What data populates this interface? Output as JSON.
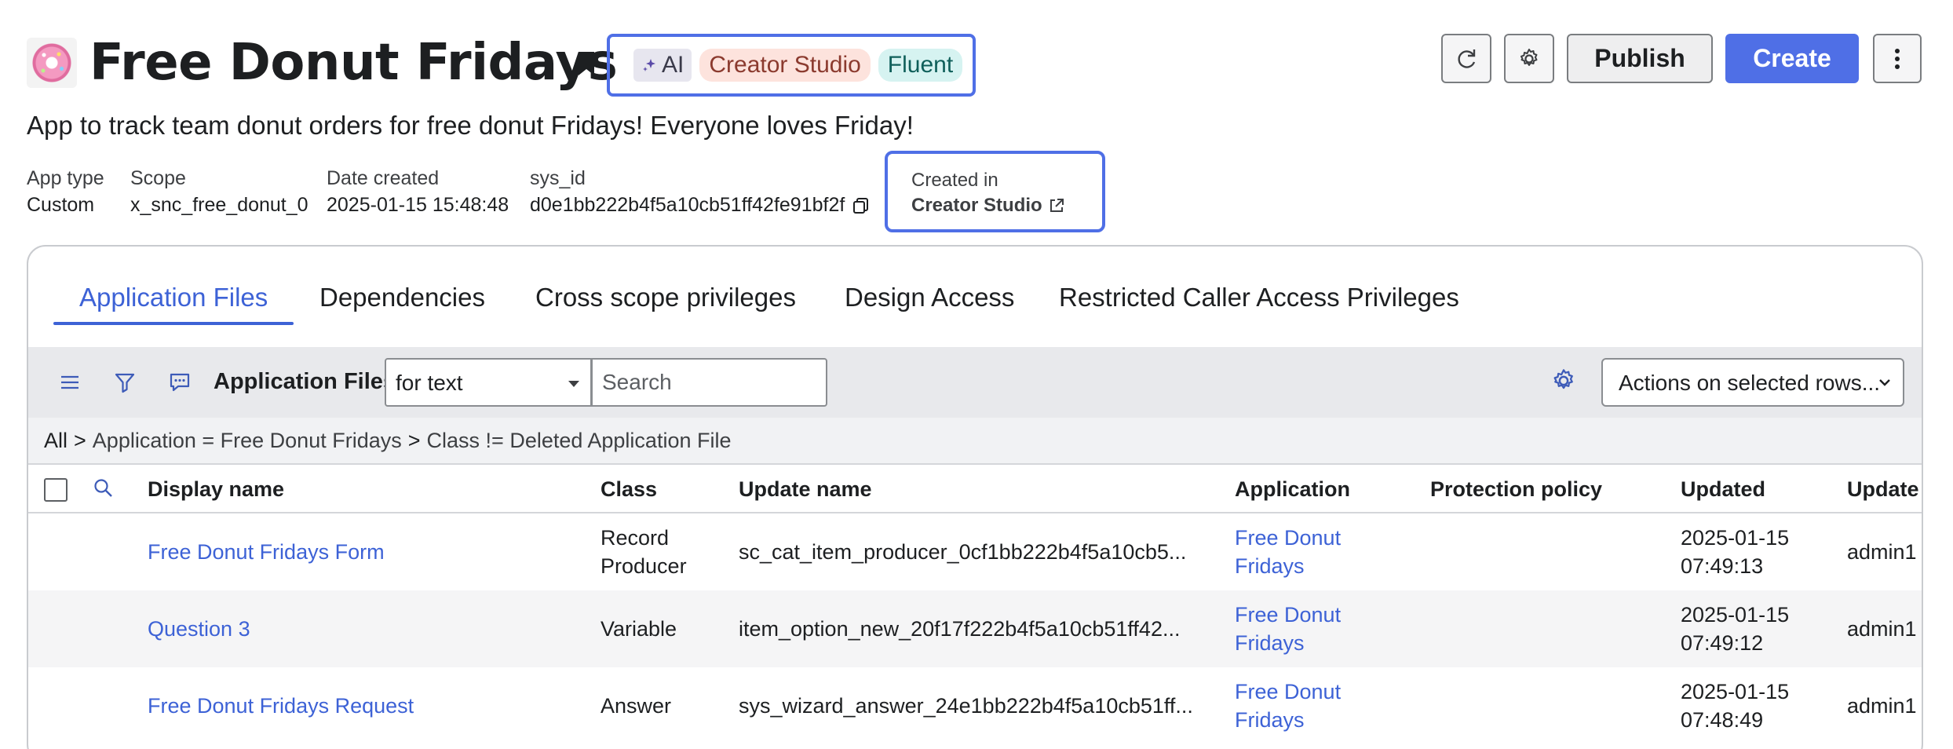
{
  "header": {
    "title": "Free Donut Fridays",
    "subtitle": "App to track team donut orders for free donut Fridays! Everyone loves Friday!",
    "tags": {
      "ai": "AI",
      "creator": "Creator Studio",
      "fluent": "Fluent"
    },
    "meta": {
      "app_type_label": "App type",
      "app_type": "Custom",
      "scope_label": "Scope",
      "scope": "x_snc_free_donut_0",
      "date_created_label": "Date created",
      "date_created": "2025-01-15 15:48:48",
      "sys_id_label": "sys_id",
      "sys_id": "d0e1bb222b4f5a10cb51ff42fe91bf2f",
      "created_in_label": "Created in",
      "created_in": "Creator Studio"
    },
    "buttons": {
      "publish": "Publish",
      "create": "Create"
    }
  },
  "tabs": [
    {
      "label": "Application Files"
    },
    {
      "label": "Dependencies"
    },
    {
      "label": "Cross scope privileges"
    },
    {
      "label": "Design Access"
    },
    {
      "label": "Restricted Caller Access Privileges"
    }
  ],
  "toolbar": {
    "label": "Application Files",
    "select_value": "for text",
    "search_placeholder": "Search",
    "actions_label": "Actions on selected rows..."
  },
  "breadcrumb": {
    "all": "All",
    "sep": ">",
    "filter1": "Application = Free Donut Fridays",
    "filter2": "Class != Deleted Application File"
  },
  "table": {
    "columns": {
      "display_name": "Display name",
      "class": "Class",
      "update_name": "Update name",
      "application": "Application",
      "protection_policy": "Protection policy",
      "updated": "Updated",
      "updated_by": "Update"
    },
    "rows": [
      {
        "display_name": "Free Donut Fridays Form",
        "class_1": "Record",
        "class_2": "Producer",
        "update_name": "sc_cat_item_producer_0cf1bb222b4f5a10cb5...",
        "app_1": "Free Donut",
        "app_2": "Fridays",
        "date": "2025-01-15",
        "time": "07:49:13",
        "by": "admin1"
      },
      {
        "display_name": "Question 3",
        "class_1": "Variable",
        "class_2": "",
        "update_name": "item_option_new_20f17f222b4f5a10cb51ff42...",
        "app_1": "Free Donut",
        "app_2": "Fridays",
        "date": "2025-01-15",
        "time": "07:49:12",
        "by": "admin1"
      },
      {
        "display_name": "Free Donut Fridays Request",
        "class_1": "Answer",
        "class_2": "",
        "update_name": "sys_wizard_answer_24e1bb222b4f5a10cb51ff...",
        "app_1": "Free Donut",
        "app_2": "Fridays",
        "date": "2025-01-15",
        "time": "07:48:49",
        "by": "admin1"
      }
    ]
  },
  "colors": {
    "accent": "#4f6fe6",
    "link": "#3d62d6"
  }
}
